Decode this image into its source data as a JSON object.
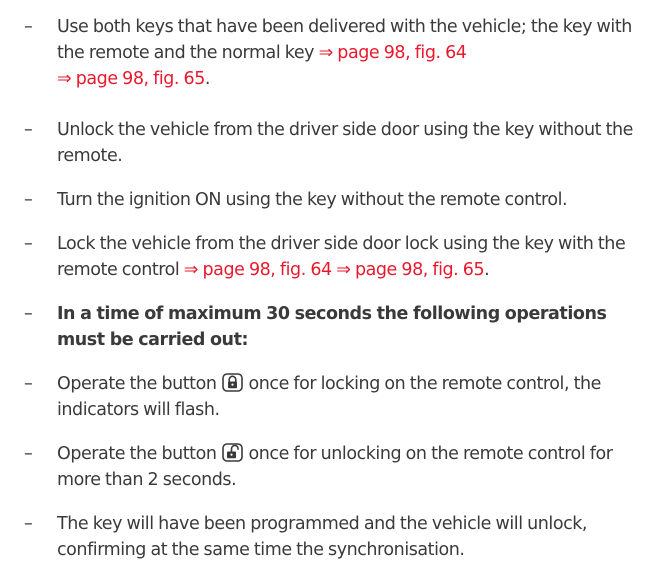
{
  "steps": [
    {
      "dash": "–",
      "text_a": "Use both keys that have been delivered with the vehicle; the key with the remote and the normal key ",
      "ref1": "⇒ page 98, fig. 64",
      "ref2": "⇒ page 98, fig. 65",
      "end": "."
    },
    {
      "dash": "–",
      "text": "Unlock the vehicle from the driver side door using the key without the remote."
    },
    {
      "dash": "–",
      "text": "Turn the ignition ON using the key without the remote control."
    },
    {
      "dash": "–",
      "text_a": "Lock the vehicle from the driver side door lock using the key with the remote control ",
      "ref1": "⇒ page 98, fig. 64",
      "ref2": "⇒ page 98, fig. 65",
      "end": "."
    },
    {
      "dash": "–",
      "text": "In a time of maximum 30 seconds the following operations must be carried out:"
    },
    {
      "dash": "–",
      "text_a": "Operate the button ",
      "icon": "lock-closed-icon",
      "text_b": " once for locking on the remote control, the indicators will flash."
    },
    {
      "dash": "–",
      "text_a": "Operate the button ",
      "icon": "lock-open-icon",
      "text_b": " once for unlocking on the remote control for more than 2 seconds."
    },
    {
      "dash": "–",
      "text": "The key will have been programmed and the vehicle will unlock, confirming at the same time the synchronisation."
    }
  ],
  "colors": {
    "text": "#3a3a3a",
    "link": "#e8192c"
  }
}
